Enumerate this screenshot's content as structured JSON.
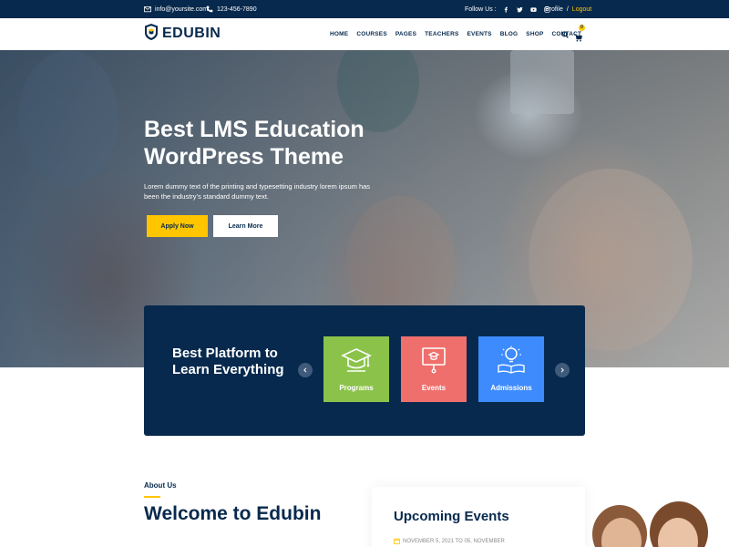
{
  "topbar": {
    "email": "info@yoursite.com",
    "phone": "123-456-7890",
    "follow_label": "Follow Us :",
    "social_icons": [
      "facebook-icon",
      "twitter-icon",
      "youtube-icon",
      "instagram-icon"
    ],
    "profile": "Profile",
    "separator": "/",
    "logout": "Logout"
  },
  "header": {
    "logo": "EDUBIN",
    "nav": [
      "HOME",
      "COURSES",
      "PAGES",
      "TEACHERS",
      "EVENTS",
      "BLOG",
      "SHOP",
      "CONTACT"
    ],
    "cart_count": "0"
  },
  "hero": {
    "title": "Best LMS Education WordPress Theme",
    "description": "Lorem dummy text of the printing and typesetting industry lorem ipsum has been the industry’s standard dummy text.",
    "apply_label": "Apply Now",
    "more_label": "Learn More"
  },
  "platform": {
    "title": "Best Platform to Learn Everything",
    "cards": [
      {
        "label": "Programs",
        "icon": "graduation-cap-icon",
        "color": "#8bc34a"
      },
      {
        "label": "Events",
        "icon": "presentation-icon",
        "color": "#ef6f6c"
      },
      {
        "label": "Admissions",
        "icon": "lightbulb-book-icon",
        "color": "#3d8bfd"
      }
    ]
  },
  "about": {
    "label": "About Us",
    "title": "Welcome to Edubin"
  },
  "events": {
    "title": "Upcoming Events",
    "date": "NOVEMBER 5, 2021 TO 05, NOVEMBER"
  },
  "colors": {
    "navy": "#07294d",
    "accent": "#ffc600"
  }
}
